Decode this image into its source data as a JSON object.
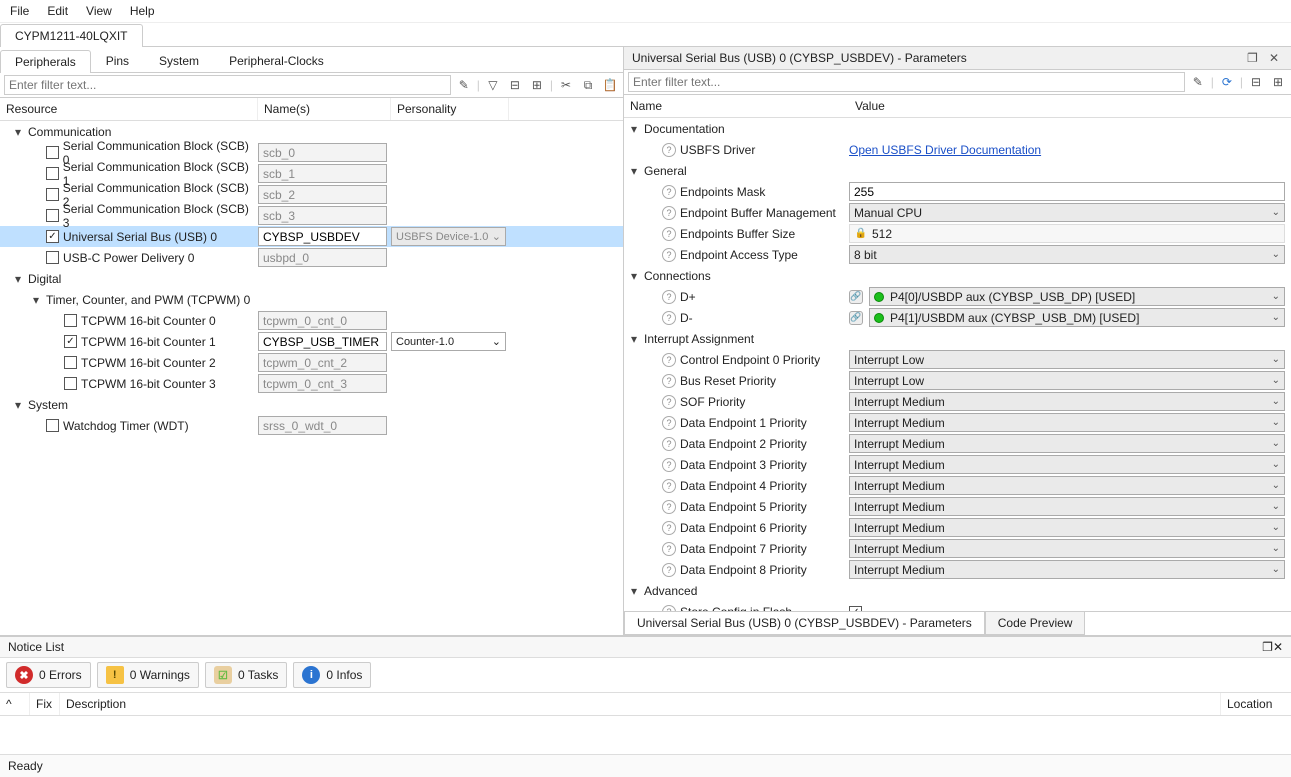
{
  "menubar": [
    "File",
    "Edit",
    "View",
    "Help"
  ],
  "device_tab": "CYPM1211-40LQXIT",
  "left": {
    "tabs": [
      "Peripherals",
      "Pins",
      "System",
      "Peripheral-Clocks"
    ],
    "active_tab": 0,
    "filter_placeholder": "Enter filter text...",
    "headers": {
      "resource": "Resource",
      "names": "Name(s)",
      "personality": "Personality"
    },
    "tree": [
      {
        "type": "group",
        "label": "Communication",
        "depth": 0
      },
      {
        "type": "item",
        "depth": 1,
        "checked": false,
        "label": "Serial Communication Block (SCB) 0",
        "name": "scb_0",
        "disabled": true
      },
      {
        "type": "item",
        "depth": 1,
        "checked": false,
        "label": "Serial Communication Block (SCB) 1",
        "name": "scb_1",
        "disabled": true
      },
      {
        "type": "item",
        "depth": 1,
        "checked": false,
        "label": "Serial Communication Block (SCB) 2",
        "name": "scb_2",
        "disabled": true
      },
      {
        "type": "item",
        "depth": 1,
        "checked": false,
        "label": "Serial Communication Block (SCB) 3",
        "name": "scb_3",
        "disabled": true
      },
      {
        "type": "item",
        "depth": 1,
        "checked": true,
        "label": "Universal Serial Bus (USB) 0",
        "name": "CYBSP_USBDEV",
        "personality": "USBFS Device-1.0",
        "pers_disabled": true,
        "selected": true
      },
      {
        "type": "item",
        "depth": 1,
        "checked": false,
        "label": "USB-C Power Delivery 0",
        "name": "usbpd_0",
        "disabled": true
      },
      {
        "type": "group",
        "label": "Digital",
        "depth": 0
      },
      {
        "type": "group",
        "label": "Timer, Counter, and PWM (TCPWM) 0",
        "depth": 1
      },
      {
        "type": "item",
        "depth": 2,
        "checked": false,
        "label": "TCPWM 16-bit Counter 0",
        "name": "tcpwm_0_cnt_0",
        "disabled": true
      },
      {
        "type": "item",
        "depth": 2,
        "checked": true,
        "label": "TCPWM 16-bit Counter 1",
        "name": "CYBSP_USB_TIMER",
        "personality": "Counter-1.0"
      },
      {
        "type": "item",
        "depth": 2,
        "checked": false,
        "label": "TCPWM 16-bit Counter 2",
        "name": "tcpwm_0_cnt_2",
        "disabled": true
      },
      {
        "type": "item",
        "depth": 2,
        "checked": false,
        "label": "TCPWM 16-bit Counter 3",
        "name": "tcpwm_0_cnt_3",
        "disabled": true
      },
      {
        "type": "group",
        "label": "System",
        "depth": 0
      },
      {
        "type": "item",
        "depth": 1,
        "checked": false,
        "label": "Watchdog Timer (WDT)",
        "name": "srss_0_wdt_0",
        "disabled": true
      }
    ]
  },
  "right": {
    "title": "Universal Serial Bus (USB) 0 (CYBSP_USBDEV) - Parameters",
    "filter_placeholder": "Enter filter text...",
    "headers": {
      "name": "Name",
      "value": "Value"
    },
    "groups": [
      {
        "label": "Documentation",
        "rows": [
          {
            "kind": "link",
            "label": "USBFS Driver",
            "value": "Open USBFS Driver Documentation"
          }
        ]
      },
      {
        "label": "General",
        "rows": [
          {
            "kind": "text",
            "label": "Endpoints Mask",
            "value": "255"
          },
          {
            "kind": "dropdown",
            "label": "Endpoint Buffer Management",
            "value": "Manual CPU"
          },
          {
            "kind": "readonly",
            "label": "Endpoints Buffer Size",
            "value": "512",
            "lock": true
          },
          {
            "kind": "dropdown",
            "label": "Endpoint Access Type",
            "value": "8 bit"
          }
        ]
      },
      {
        "label": "Connections",
        "rows": [
          {
            "kind": "conn",
            "label": "D+",
            "value": "P4[0]/USBDP aux (CYBSP_USB_DP) [USED]"
          },
          {
            "kind": "conn",
            "label": "D-",
            "value": "P4[1]/USBDM aux (CYBSP_USB_DM) [USED]"
          }
        ]
      },
      {
        "label": "Interrupt Assignment",
        "rows": [
          {
            "kind": "dropdown",
            "label": "Control Endpoint 0 Priority",
            "value": "Interrupt Low"
          },
          {
            "kind": "dropdown",
            "label": "Bus Reset Priority",
            "value": "Interrupt Low"
          },
          {
            "kind": "dropdown",
            "label": "SOF Priority",
            "value": "Interrupt Medium"
          },
          {
            "kind": "dropdown",
            "label": "Data Endpoint 1 Priority",
            "value": "Interrupt Medium"
          },
          {
            "kind": "dropdown",
            "label": "Data Endpoint 2 Priority",
            "value": "Interrupt Medium"
          },
          {
            "kind": "dropdown",
            "label": "Data Endpoint 3 Priority",
            "value": "Interrupt Medium"
          },
          {
            "kind": "dropdown",
            "label": "Data Endpoint 4 Priority",
            "value": "Interrupt Medium"
          },
          {
            "kind": "dropdown",
            "label": "Data Endpoint 5 Priority",
            "value": "Interrupt Medium"
          },
          {
            "kind": "dropdown",
            "label": "Data Endpoint 6 Priority",
            "value": "Interrupt Medium"
          },
          {
            "kind": "dropdown",
            "label": "Data Endpoint 7 Priority",
            "value": "Interrupt Medium"
          },
          {
            "kind": "dropdown",
            "label": "Data Endpoint 8 Priority",
            "value": "Interrupt Medium"
          }
        ]
      },
      {
        "label": "Advanced",
        "rows": [
          {
            "kind": "check",
            "label": "Store Config in Flash",
            "checked": true
          }
        ]
      }
    ],
    "bottom_tabs": [
      "Universal Serial Bus (USB) 0 (CYBSP_USBDEV) - Parameters",
      "Code Preview"
    ],
    "bottom_active": 0
  },
  "notice": {
    "title": "Notice List",
    "buttons": [
      {
        "icon": "err",
        "label": "0 Errors"
      },
      {
        "icon": "warn",
        "label": "0 Warnings"
      },
      {
        "icon": "task",
        "label": "0 Tasks"
      },
      {
        "icon": "info",
        "label": "0 Infos"
      }
    ],
    "cols": {
      "fix": "Fix",
      "desc": "Description",
      "loc": "Location"
    }
  },
  "status": "Ready"
}
